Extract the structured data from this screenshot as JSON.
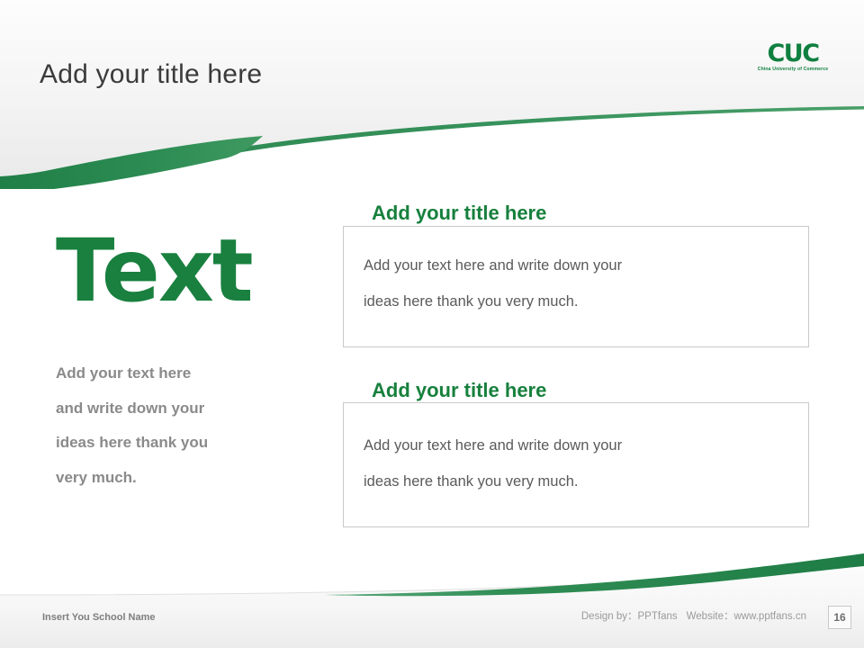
{
  "slide": {
    "title": "Add your title here",
    "page_number": "16",
    "accent_green": "#19803f",
    "logo_green": "#0f8040",
    "body_gray": "#5a5a5a",
    "left_body_gray": "#8a8a8a",
    "border_gray": "#c9c9c9"
  },
  "logo": {
    "mark": "CUC",
    "subtitle": "China University of Commerce"
  },
  "left": {
    "headline": "Text",
    "paragraph_lines": [
      "Add your text here",
      "and write down your",
      "ideas here thank you",
      "very much."
    ]
  },
  "panels": [
    {
      "title": "Add your title here",
      "body_lines": [
        "Add your text here and write down your",
        "ideas here thank you very much."
      ]
    },
    {
      "title": "Add your title here",
      "body_lines": [
        "Add your text here and write down your",
        "ideas here thank you very much."
      ]
    }
  ],
  "footer": {
    "school_name": "Insert You School Name",
    "design_by": "Design by：PPTfans",
    "website": "Website：www.pptfans.cn"
  }
}
